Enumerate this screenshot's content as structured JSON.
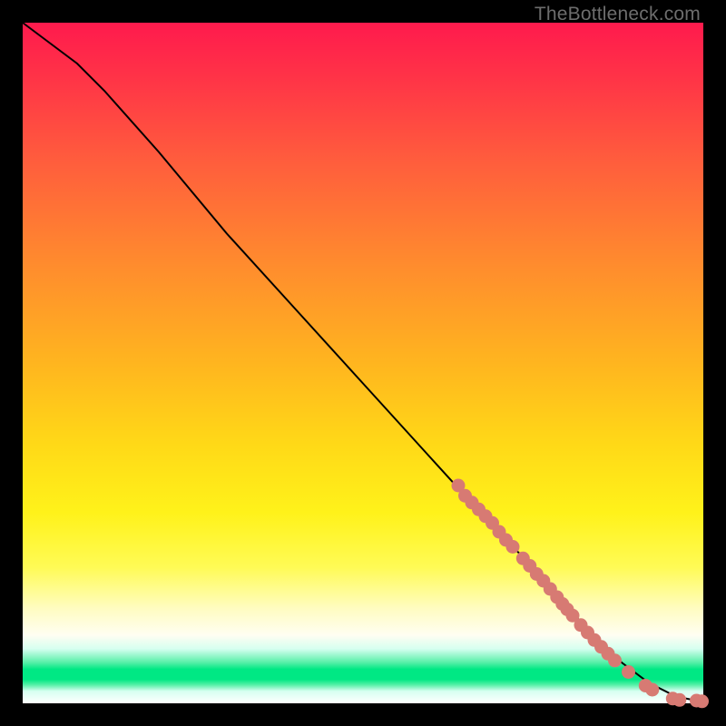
{
  "watermark": "TheBottleneck.com",
  "colors": {
    "marker": "#d77a73",
    "curve": "#000000",
    "frame": "#000000"
  },
  "chart_data": {
    "type": "line",
    "title": "",
    "xlabel": "",
    "ylabel": "",
    "xlim": [
      0,
      100
    ],
    "ylim": [
      0,
      100
    ],
    "grid": false,
    "curve": {
      "x": [
        0,
        4,
        8,
        12,
        20,
        30,
        40,
        50,
        60,
        70,
        76,
        80,
        84,
        88,
        92,
        95,
        97,
        99,
        100
      ],
      "y": [
        100,
        97,
        94,
        90,
        81,
        69,
        58,
        47,
        36,
        25,
        19,
        14,
        10,
        6,
        3,
        1.5,
        0.8,
        0.4,
        0.3
      ]
    },
    "markers": [
      {
        "x": 64,
        "y": 32,
        "r": 1.0
      },
      {
        "x": 65,
        "y": 30.5,
        "r": 1.0
      },
      {
        "x": 66,
        "y": 29.5,
        "r": 1.0
      },
      {
        "x": 67,
        "y": 28.5,
        "r": 1.0
      },
      {
        "x": 68,
        "y": 27.5,
        "r": 1.0
      },
      {
        "x": 69,
        "y": 26.5,
        "r": 1.0
      },
      {
        "x": 70,
        "y": 25.2,
        "r": 1.0
      },
      {
        "x": 71,
        "y": 24.0,
        "r": 1.0
      },
      {
        "x": 72,
        "y": 23.0,
        "r": 1.0
      },
      {
        "x": 73.5,
        "y": 21.3,
        "r": 1.0
      },
      {
        "x": 74.5,
        "y": 20.2,
        "r": 1.0
      },
      {
        "x": 75.5,
        "y": 19.0,
        "r": 1.0
      },
      {
        "x": 76.5,
        "y": 18.0,
        "r": 1.0
      },
      {
        "x": 77.5,
        "y": 16.8,
        "r": 1.0
      },
      {
        "x": 78.5,
        "y": 15.6,
        "r": 1.0
      },
      {
        "x": 79.3,
        "y": 14.6,
        "r": 1.0
      },
      {
        "x": 80.0,
        "y": 13.8,
        "r": 1.0
      },
      {
        "x": 80.8,
        "y": 12.9,
        "r": 1.0
      },
      {
        "x": 82.0,
        "y": 11.5,
        "r": 1.0
      },
      {
        "x": 83.0,
        "y": 10.4,
        "r": 1.0
      },
      {
        "x": 84.0,
        "y": 9.3,
        "r": 1.0
      },
      {
        "x": 85.0,
        "y": 8.3,
        "r": 1.0
      },
      {
        "x": 86.0,
        "y": 7.3,
        "r": 1.0
      },
      {
        "x": 87.0,
        "y": 6.3,
        "r": 1.0
      },
      {
        "x": 89.0,
        "y": 4.6,
        "r": 1.0
      },
      {
        "x": 91.5,
        "y": 2.6,
        "r": 1.0
      },
      {
        "x": 92.5,
        "y": 2.0,
        "r": 1.0
      },
      {
        "x": 95.5,
        "y": 0.7,
        "r": 1.0
      },
      {
        "x": 96.5,
        "y": 0.5,
        "r": 1.0
      },
      {
        "x": 99.0,
        "y": 0.4,
        "r": 1.0
      },
      {
        "x": 99.8,
        "y": 0.3,
        "r": 1.0
      }
    ]
  }
}
